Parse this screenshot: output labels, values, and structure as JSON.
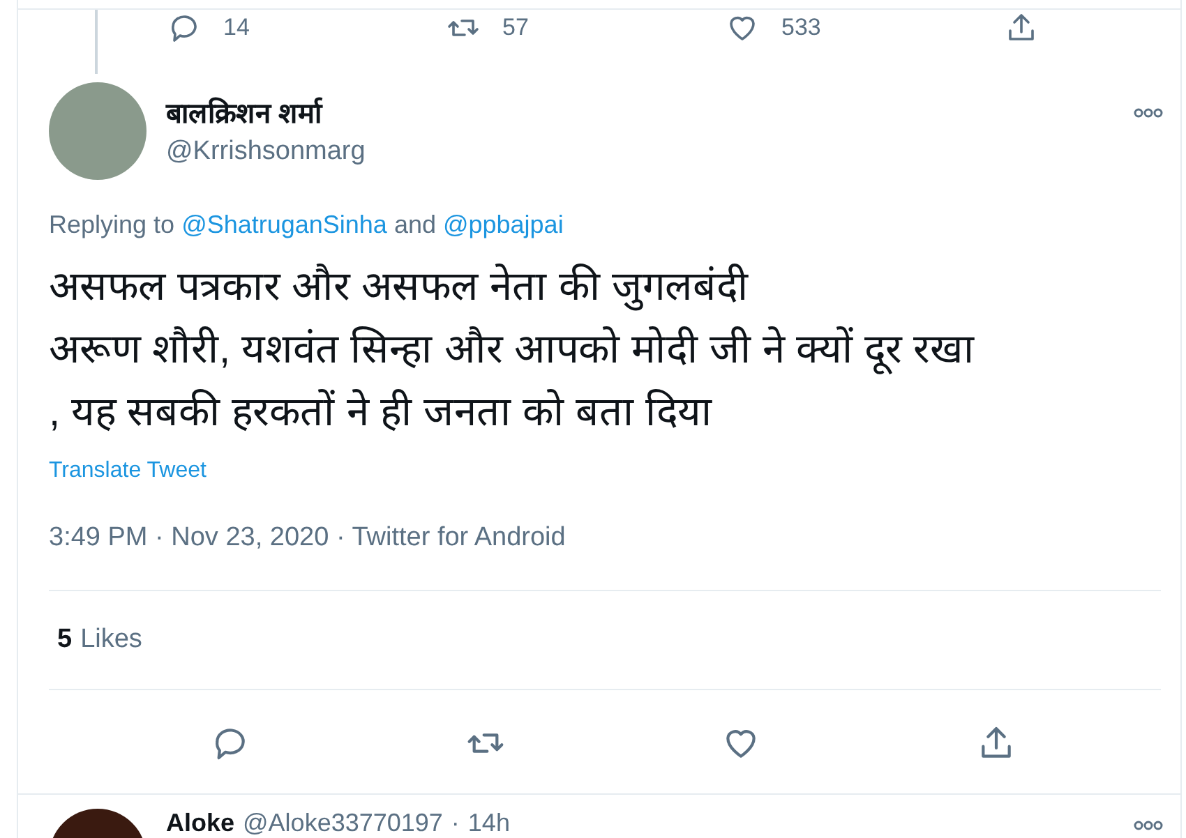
{
  "parent_tweet": {
    "actions": [
      {
        "kind": "reply",
        "count": "14"
      },
      {
        "kind": "retweet",
        "count": "57"
      },
      {
        "kind": "like",
        "count": "533"
      },
      {
        "kind": "share"
      }
    ]
  },
  "tweet": {
    "author": {
      "name": "बालक्रिशन शर्मा",
      "handle": "@Krrishsonmarg"
    },
    "replying_to": {
      "prefix": "Replying to",
      "users": [
        "@ShatruganSinha",
        "@ppbajpai"
      ],
      "joiner": "and"
    },
    "lines": [
      "असफल पत्रकार और असफल नेता की जुगलबंदी",
      "अरूण शौरी, यशवंत सिन्हा और आपको मोदी जी ने क्यों दूर रखा",
      ", यह सबकी हरकतों ने ही जनता को बता दिया"
    ],
    "translate": "Translate Tweet",
    "meta": "3:49 PM · Nov 23, 2020 · Twitter for Android",
    "likes": {
      "count": "5",
      "label": "Likes"
    },
    "actions": [
      {
        "kind": "reply"
      },
      {
        "kind": "retweet"
      },
      {
        "kind": "like"
      },
      {
        "kind": "share"
      }
    ]
  },
  "next_reply": {
    "name": "Aloke",
    "handle": "@Aloke33770197",
    "separator": "·",
    "time": "14h"
  }
}
